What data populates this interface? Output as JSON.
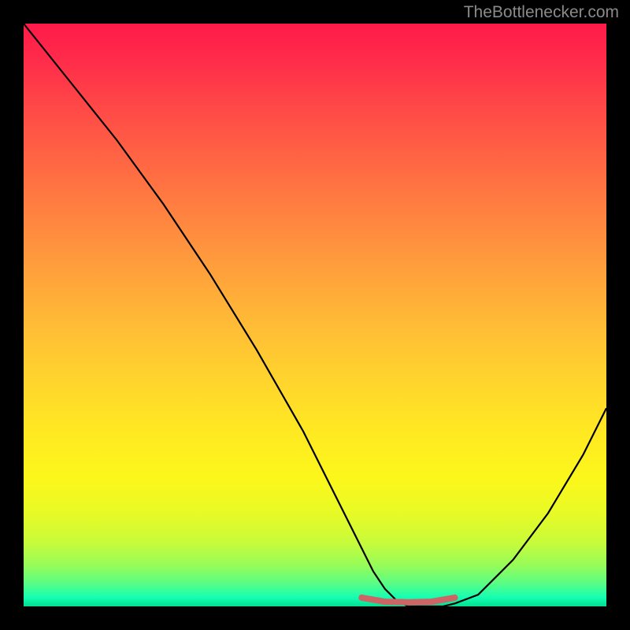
{
  "watermark": "TheBottlenecker.com",
  "chart_data": {
    "type": "line",
    "title": "",
    "xlabel": "",
    "ylabel": "",
    "xlim": [
      0,
      100
    ],
    "ylim": [
      0,
      100
    ],
    "series": [
      {
        "name": "curve",
        "x": [
          0,
          8,
          16,
          24,
          32,
          40,
          48,
          56,
          60,
          62,
          64,
          66,
          68,
          70,
          72,
          74,
          78,
          84,
          90,
          96,
          100
        ],
        "y": [
          100,
          90,
          80,
          69,
          57,
          44,
          30,
          14,
          6,
          3,
          1,
          0,
          0,
          0,
          0,
          0.5,
          2,
          8,
          16,
          26,
          34
        ]
      },
      {
        "name": "optimum-marker",
        "x": [
          58,
          62,
          66,
          70,
          74
        ],
        "y": [
          1.5,
          0.8,
          0.7,
          0.8,
          1.5
        ]
      }
    ],
    "annotations": []
  },
  "colors": {
    "curve": "#000000",
    "marker": "#cc6666",
    "background_top": "#ff1a4a",
    "background_bottom": "#06df92"
  }
}
